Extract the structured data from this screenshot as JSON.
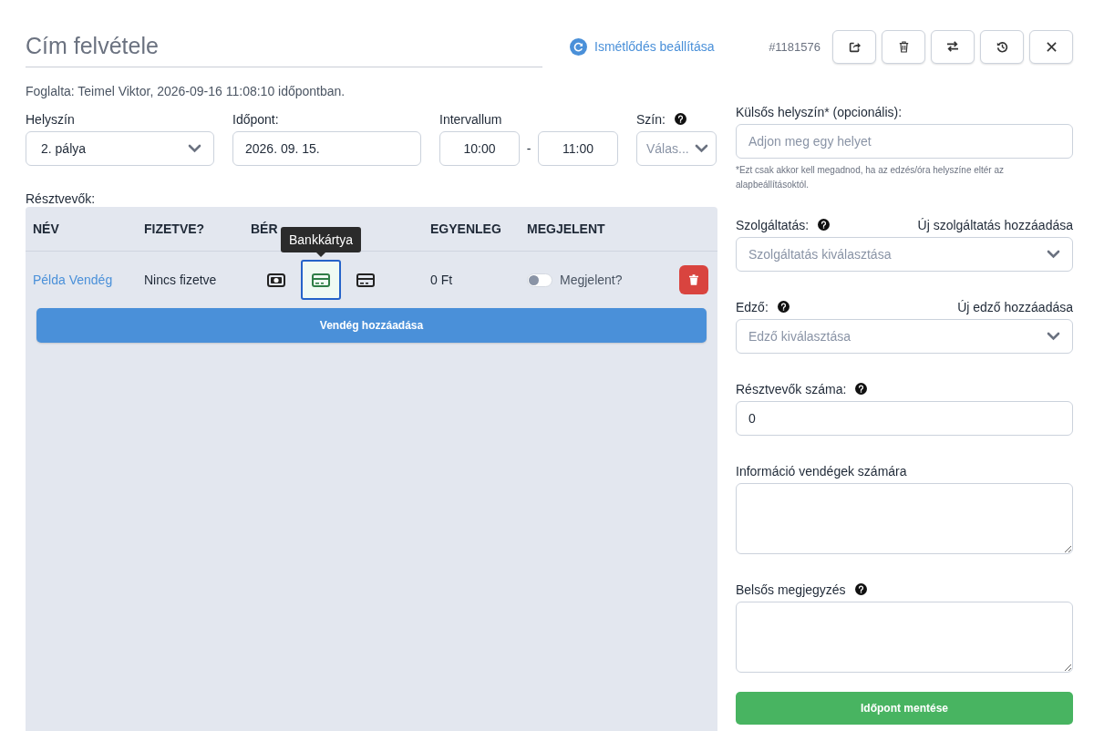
{
  "title_field": {
    "placeholder": "Cím felvétele"
  },
  "recurrence_link": "Ismétlődés beállítása",
  "booking_id": "#1181576",
  "toolbar_buttons": [
    {
      "kind": "share"
    },
    {
      "kind": "delete"
    },
    {
      "kind": "swap"
    },
    {
      "kind": "history"
    },
    {
      "kind": "close"
    }
  ],
  "booked_by": "Foglalta: Teimel Viktor, 2026-09-16 11:08:10 időpontban.",
  "location": {
    "label": "Helyszín",
    "value": "2. pálya"
  },
  "date": {
    "label": "Időpont:",
    "value": "2026. 09. 15."
  },
  "interval": {
    "label": "Intervallum",
    "from": "10:00",
    "separator": "-",
    "to": "11:00"
  },
  "color": {
    "label": "Szín:",
    "placeholder": "Válas..."
  },
  "participants": {
    "label": "Résztvevők:",
    "columns": [
      "NÉV",
      "FIZETVE?",
      "BÉR",
      "EGYENLEG",
      "MEGJELENT"
    ],
    "rows": [
      {
        "name": "Példa Vendég",
        "paid_status": "Nincs fizetve",
        "payment_options": [
          {
            "kind": "cash",
            "selected": false
          },
          {
            "kind": "card",
            "selected": true
          },
          {
            "kind": "card",
            "selected": false
          }
        ],
        "balance": "0 Ft",
        "attended": false,
        "attended_label": "Megjelent?"
      }
    ],
    "tooltip": "Bankkártya",
    "add_button": "Vendég hozzáadása"
  },
  "external_location": {
    "label": "Külsős helyszín* (opcionális):",
    "placeholder": "Adjon meg egy helyet",
    "hint": "*Ezt csak akkor kell megadnod, ha az edzés/óra helyszíne eltér az alapbeállításoktól."
  },
  "service": {
    "label": "Szolgáltatás:",
    "add_link": "Új szolgáltatás hozzáadása",
    "placeholder": "Szolgáltatás kiválasztása"
  },
  "coach": {
    "label": "Edző:",
    "add_link": "Új edző hozzáadása",
    "placeholder": "Edző kiválasztása"
  },
  "participant_count": {
    "label": "Résztvevők száma:",
    "value": "0"
  },
  "guest_info": {
    "label": "Információ vendégek számára"
  },
  "internal_note": {
    "label": "Belsős megjegyzés"
  },
  "save_button": "Időpont mentése"
}
